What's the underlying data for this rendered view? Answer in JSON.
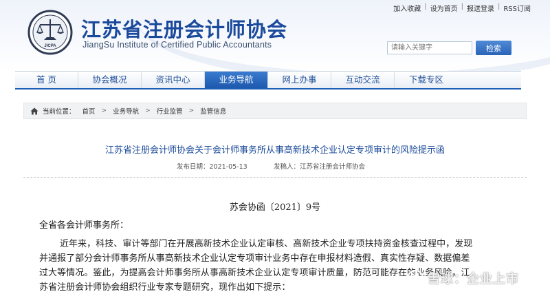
{
  "header": {
    "title": "江苏省注册会计师协会",
    "subtitle": "JiangSu Institute of Certified Public Accountants",
    "logo_text": "JICPA",
    "top_links": [
      "加入收藏",
      "设为首页",
      "报送登录",
      "RSS订阅"
    ],
    "search": {
      "placeholder": "请输入关键字",
      "button_label": "检索"
    }
  },
  "nav": {
    "items": [
      "首 页",
      "协会概况",
      "资讯中心",
      "业务导航",
      "网上办事",
      "互动交流",
      "下载专区"
    ],
    "active_index": 3
  },
  "breadcrumb": {
    "prefix": "当前位置：",
    "items": [
      "首页",
      "业务导航",
      "行业监管",
      "监管信息"
    ]
  },
  "article": {
    "title": "江苏省注册会计师协会关于会计师事务所从事高新技术企业认定专项审计的风险提示函",
    "date_label": "发布日期：",
    "date": "2021-05-13",
    "source_label": "发稿人：",
    "source": "江苏省注册会计师协会",
    "doc_number": "苏会协函〔2021〕9号",
    "salutation": "全省各会计师事务所：",
    "body_lines": [
      "近年来，科技、审计等部门在开展高新技术企业认定审核、高新技术企业专项扶持资金核查过程中，发现",
      "并通报了部分会计师事务所从事高新技术企业认定专项审计业务中存在申报材料造假、真实性存疑、数据偏差",
      "过大等情况。鉴此，为提高会计师事务所从事高新技术企业认定专项审计质量，防范可能存在的业务风险，江",
      "苏省注册会计师协会组织行业专家专题研究，现作出如下提示："
    ]
  },
  "watermark": {
    "text": "雪球：企业上市"
  },
  "colors": {
    "brand_blue": "#1b4a9c",
    "nav_active": "#2a64b8",
    "title_blue": "#1d4c9a"
  }
}
